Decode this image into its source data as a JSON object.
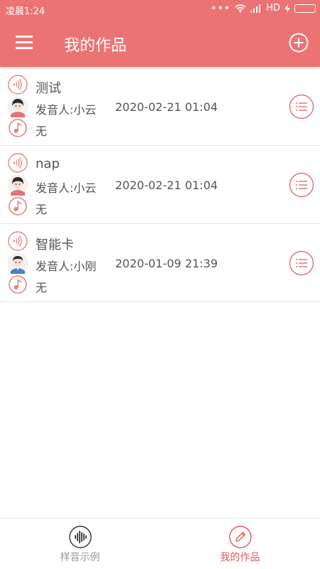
{
  "status_bar": {
    "time": "凌晨1:24",
    "network": "HD",
    "battery_color": "#58c23a"
  },
  "header": {
    "title": "我的作品",
    "menu_icon": "hamburger-menu-icon",
    "add_icon": "plus-circle-icon",
    "background": "#ec7374"
  },
  "works": [
    {
      "name": "测试",
      "speaker": "发音人:小云",
      "datetime": "2020-02-21 01:04",
      "music": "无",
      "avatar": "female"
    },
    {
      "name": "nap",
      "speaker": "发音人:小云",
      "datetime": "2020-02-21 01:04",
      "music": "无",
      "avatar": "female"
    },
    {
      "name": "智能卡",
      "speaker": "发音人:小刚",
      "datetime": "2020-01-09 21:39",
      "music": "无",
      "avatar": "male"
    }
  ],
  "bottom_nav": {
    "tabs": [
      {
        "label": "样音示例",
        "icon": "sound-wave-icon",
        "active": false
      },
      {
        "label": "我的作品",
        "icon": "edit-pencil-icon",
        "active": true
      }
    ]
  }
}
